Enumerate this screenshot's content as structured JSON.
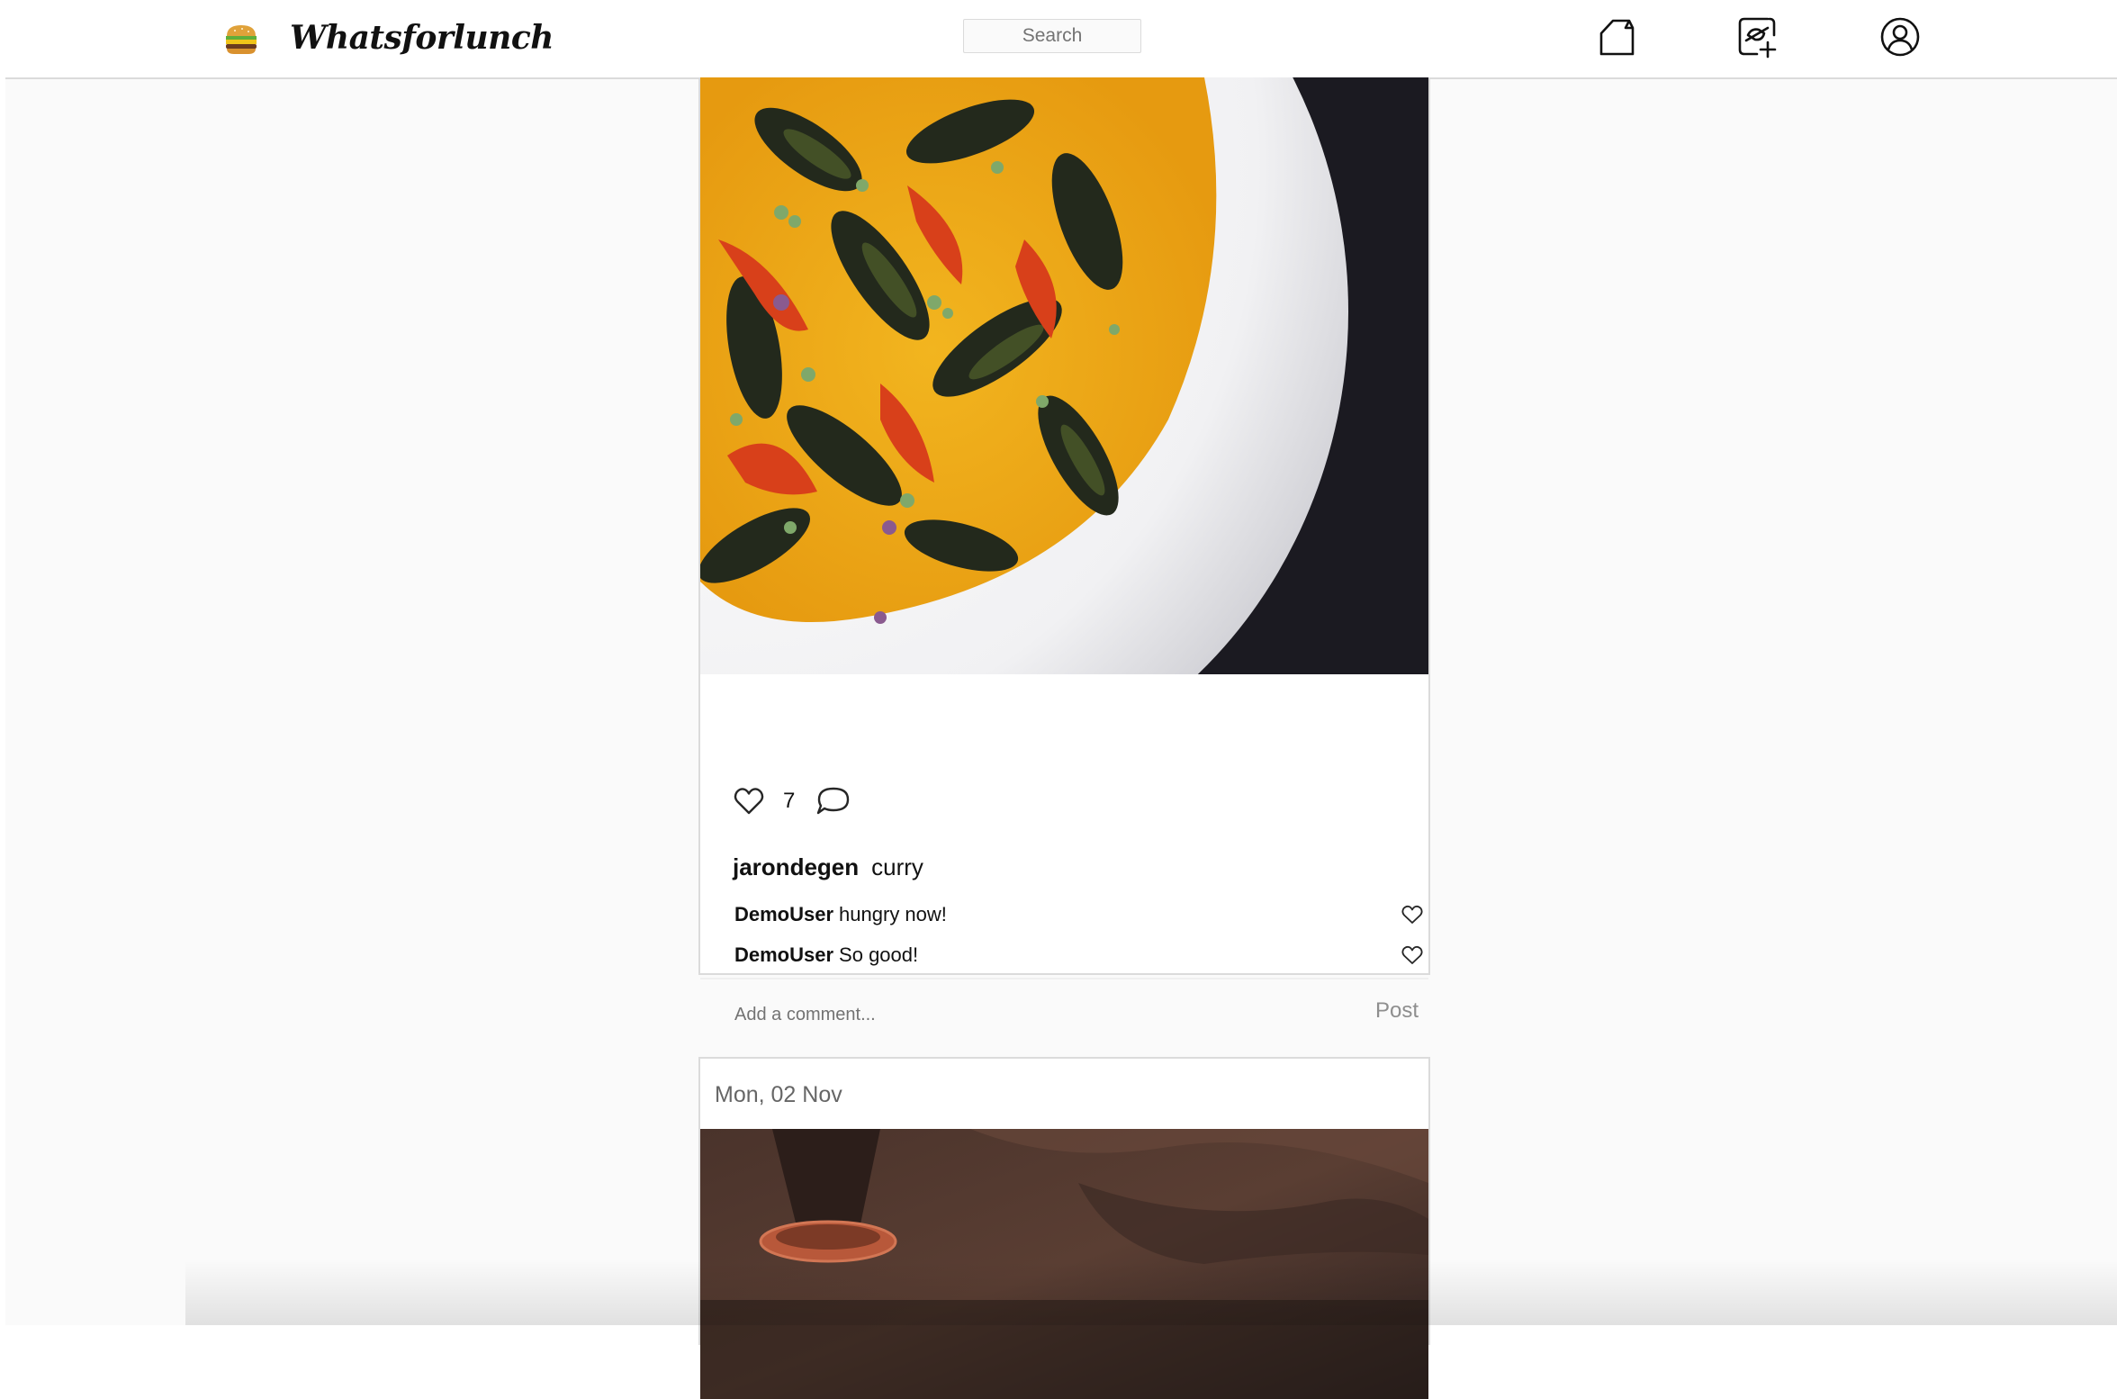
{
  "app": {
    "brand": "Whatsforlunch",
    "logo_icon": "burger-icon"
  },
  "nav": {
    "search_placeholder": "Search",
    "icons": [
      "home-icon",
      "new-post-icon",
      "profile-icon"
    ]
  },
  "posts": [
    {
      "image_description_icon": "food-photo-mussels",
      "likes": "7",
      "author": "jarondegen",
      "caption": "curry",
      "comments": [
        {
          "user": "DemoUser",
          "text": "hungry now!"
        },
        {
          "user": "DemoUser",
          "text": "So good!"
        }
      ],
      "add_comment_placeholder": "Add a comment...",
      "post_label": "Post"
    },
    {
      "date": "Mon, 02 Nov",
      "image_description_icon": "food-photo"
    }
  ],
  "colors": {
    "border": "#dbdbdb",
    "background": "#fafafa",
    "muted_text": "#8e8e8e"
  }
}
